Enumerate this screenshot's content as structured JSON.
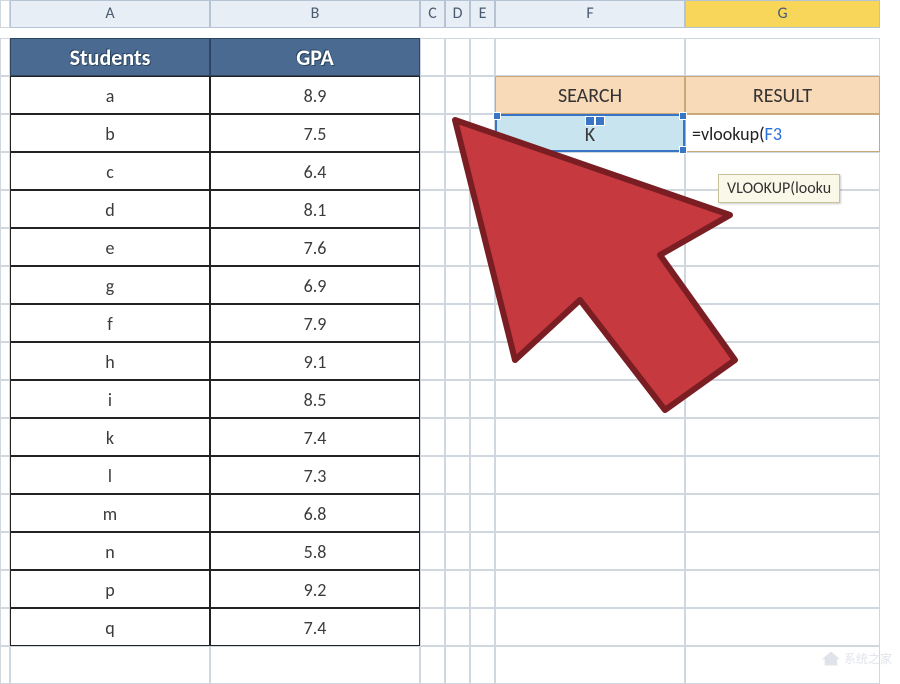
{
  "columns": [
    "A",
    "B",
    "C",
    "D",
    "E",
    "F",
    "G"
  ],
  "active_column": "G",
  "table": {
    "headers": {
      "students": "Students",
      "gpa": "GPA"
    },
    "rows": [
      {
        "student": "a",
        "gpa": "8.9"
      },
      {
        "student": "b",
        "gpa": "7.5"
      },
      {
        "student": "c",
        "gpa": "6.4"
      },
      {
        "student": "d",
        "gpa": "8.1"
      },
      {
        "student": "e",
        "gpa": "7.6"
      },
      {
        "student": "g",
        "gpa": "6.9"
      },
      {
        "student": "f",
        "gpa": "7.9"
      },
      {
        "student": "h",
        "gpa": "9.1"
      },
      {
        "student": "i",
        "gpa": "8.5"
      },
      {
        "student": "k",
        "gpa": "7.4"
      },
      {
        "student": "l",
        "gpa": "7.3"
      },
      {
        "student": "m",
        "gpa": "6.8"
      },
      {
        "student": "n",
        "gpa": "5.8"
      },
      {
        "student": "p",
        "gpa": "9.2"
      },
      {
        "student": "q",
        "gpa": "7.4"
      }
    ]
  },
  "lookup": {
    "search_label": "SEARCH",
    "result_label": "RESULT",
    "search_value": "K",
    "formula_prefix": "=vlookup(",
    "formula_ref": "F3",
    "tooltip": "VLOOKUP(looku"
  },
  "watermark_text": "系统之家"
}
